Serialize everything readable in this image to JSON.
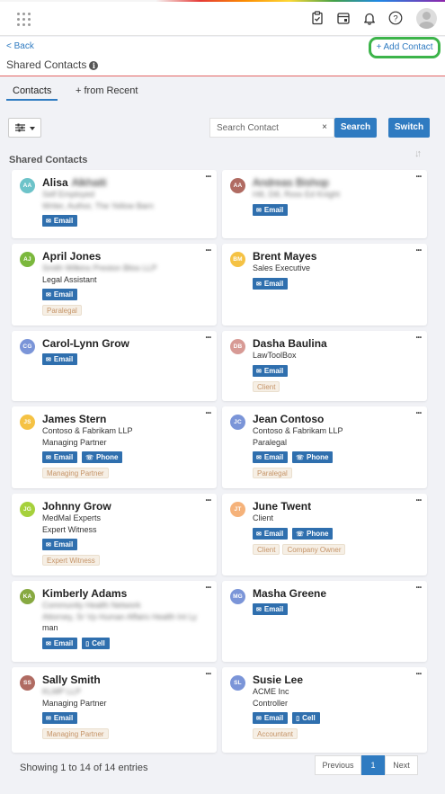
{
  "header": {
    "back": "< Back",
    "title": "Shared Contacts",
    "add_contact": "+ Add Contact"
  },
  "tabs": [
    {
      "label": "Contacts",
      "active": true
    },
    {
      "label": "+ from Recent",
      "active": false
    }
  ],
  "search": {
    "placeholder": "Search Contact",
    "clear": "×",
    "search_label": "Search",
    "switch_label": "Switch"
  },
  "section_label": "Shared Contacts",
  "colors": {
    "primary_blue": "#2f7bc1",
    "add_contact_highlight": "#3cb44a",
    "tag_text": "#c59468"
  },
  "contacts": [
    {
      "initials": "AA",
      "color": "#6dc3c9",
      "name": "Alisa",
      "name_blurred": "Alkhaiti",
      "lines": [
        {
          "text": "Self Employed",
          "blurred": true
        },
        {
          "text": "Writer, Author, The Yellow Barn",
          "blurred": true
        }
      ],
      "buttons": [
        "Email"
      ],
      "tags": []
    },
    {
      "initials": "AA",
      "color": "#b06b62",
      "name": "",
      "name_blurred": "Andreas Bishop",
      "lines": [
        {
          "text": "Hill, Dill, Ross Ed Knight",
          "blurred": true
        }
      ],
      "buttons": [
        "Email"
      ],
      "tags": []
    },
    {
      "initials": "AJ",
      "color": "#7bb83d",
      "name": "April Jones",
      "name_blurred": "",
      "lines": [
        {
          "text": "Smith Wilkins Preston Bliss LLP",
          "blurred": true
        },
        {
          "text": "Legal Assistant",
          "blurred": false
        }
      ],
      "buttons": [
        "Email"
      ],
      "tags": [
        "Paralegal"
      ]
    },
    {
      "initials": "BM",
      "color": "#f5c244",
      "name": "Brent Mayes",
      "name_blurred": "",
      "lines": [
        {
          "text": "Sales Executive",
          "blurred": false
        }
      ],
      "buttons": [
        "Email"
      ],
      "tags": []
    },
    {
      "initials": "CG",
      "color": "#7b95d8",
      "name": "Carol-Lynn Grow",
      "name_blurred": "",
      "lines": [],
      "buttons": [
        "Email"
      ],
      "tags": []
    },
    {
      "initials": "DB",
      "color": "#d79a95",
      "name": "Dasha Baulina",
      "name_blurred": "",
      "lines": [
        {
          "text": "LawToolBox",
          "blurred": false
        }
      ],
      "buttons": [
        "Email"
      ],
      "tags": [
        "Client"
      ]
    },
    {
      "initials": "JS",
      "color": "#f5c244",
      "name": "James Stern",
      "name_blurred": "",
      "lines": [
        {
          "text": "Contoso & Fabrikam LLP",
          "blurred": false
        },
        {
          "text": "Managing Partner",
          "blurred": false
        }
      ],
      "buttons": [
        "Email",
        "Phone"
      ],
      "tags": [
        "Managing Partner"
      ]
    },
    {
      "initials": "JC",
      "color": "#7b95d8",
      "name": "Jean Contoso",
      "name_blurred": "",
      "lines": [
        {
          "text": "Contoso & Fabrikam LLP",
          "blurred": false
        },
        {
          "text": "Paralegal",
          "blurred": false
        }
      ],
      "buttons": [
        "Email",
        "Phone"
      ],
      "tags": [
        "Paralegal"
      ]
    },
    {
      "initials": "JG",
      "color": "#a6d13c",
      "name": "Johnny Grow",
      "name_blurred": "",
      "lines": [
        {
          "text": "MedMal Experts",
          "blurred": false
        },
        {
          "text": "Expert Witness",
          "blurred": false
        }
      ],
      "buttons": [
        "Email"
      ],
      "tags": [
        "Expert Witness"
      ]
    },
    {
      "initials": "JT",
      "color": "#f5b27a",
      "name": "June Twent",
      "name_blurred": "",
      "lines": [
        {
          "text": "Client",
          "blurred": false
        }
      ],
      "buttons": [
        "Email",
        "Phone"
      ],
      "tags": [
        "Client",
        "Company Owner"
      ]
    },
    {
      "initials": "KA",
      "color": "#87a941",
      "name": "Kimberly Adams",
      "name_blurred": "",
      "lines": [
        {
          "text": "Community Health Network",
          "blurred": true
        },
        {
          "text": "Attorney, Sr Vp Human Affairs Health Int Ly",
          "blurred": true
        },
        {
          "text": "man",
          "blurred": false
        }
      ],
      "buttons": [
        "Email",
        "Cell"
      ],
      "tags": []
    },
    {
      "initials": "MG",
      "color": "#7b95d8",
      "name": "Masha Greene",
      "name_blurred": "",
      "lines": [],
      "buttons": [
        "Email"
      ],
      "tags": []
    },
    {
      "initials": "SS",
      "color": "#b06b62",
      "name": "Sally Smith",
      "name_blurred": "",
      "lines": [
        {
          "text": "KLMP LLP",
          "blurred": true
        },
        {
          "text": "Managing Partner",
          "blurred": false
        }
      ],
      "buttons": [
        "Email"
      ],
      "tags": [
        "Managing Partner"
      ]
    },
    {
      "initials": "SL",
      "color": "#7b95d8",
      "name": "Susie Lee",
      "name_blurred": "",
      "lines": [
        {
          "text": "ACME Inc",
          "blurred": false
        },
        {
          "text": "Controller",
          "blurred": false
        }
      ],
      "buttons": [
        "Email",
        "Cell"
      ],
      "tags": [
        "Accountant"
      ]
    }
  ],
  "footer": {
    "entries": "Showing 1 to 14 of 14 entries",
    "previous": "Previous",
    "page": "1",
    "next": "Next"
  }
}
